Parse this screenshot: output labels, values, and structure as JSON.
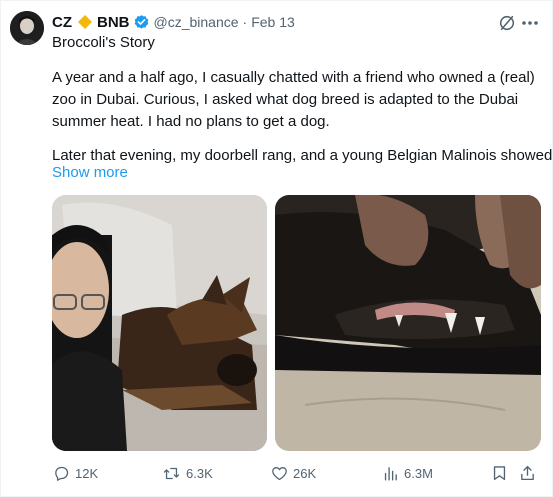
{
  "author": {
    "name": "CZ",
    "org": "BNB",
    "handle": "@cz_binance",
    "separator": "·",
    "date": "Feb 13"
  },
  "post": {
    "title": "Broccoli's Story",
    "paragraph1": "A year and a half ago, I casually chatted with a friend who owned a (real) zoo in Dubai. Curious, I asked what dog breed is adapted to the Dubai summer heat. I had no plans to get a dog.",
    "paragraph2": "Later that evening, my doorbell rang, and a young Belgian Malinois showed",
    "show_more": "Show more"
  },
  "metrics": {
    "replies": "12K",
    "reposts": "6.3K",
    "likes": "26K",
    "views": "6.3M"
  },
  "icons": {
    "avatar": "avatar-icon",
    "diamond": "diamond-icon",
    "verified": "verified-badge-icon",
    "grok": "grok-icon",
    "more": "more-icon",
    "reply": "reply-icon",
    "repost": "repost-icon",
    "like": "heart-icon",
    "views": "views-icon",
    "bookmark": "bookmark-icon",
    "share": "share-icon"
  },
  "colors": {
    "text": "#0f1419",
    "secondary": "#536471",
    "link": "#1d9bf0",
    "verified": "#1d9bf0",
    "diamond": "#f0b90b"
  }
}
